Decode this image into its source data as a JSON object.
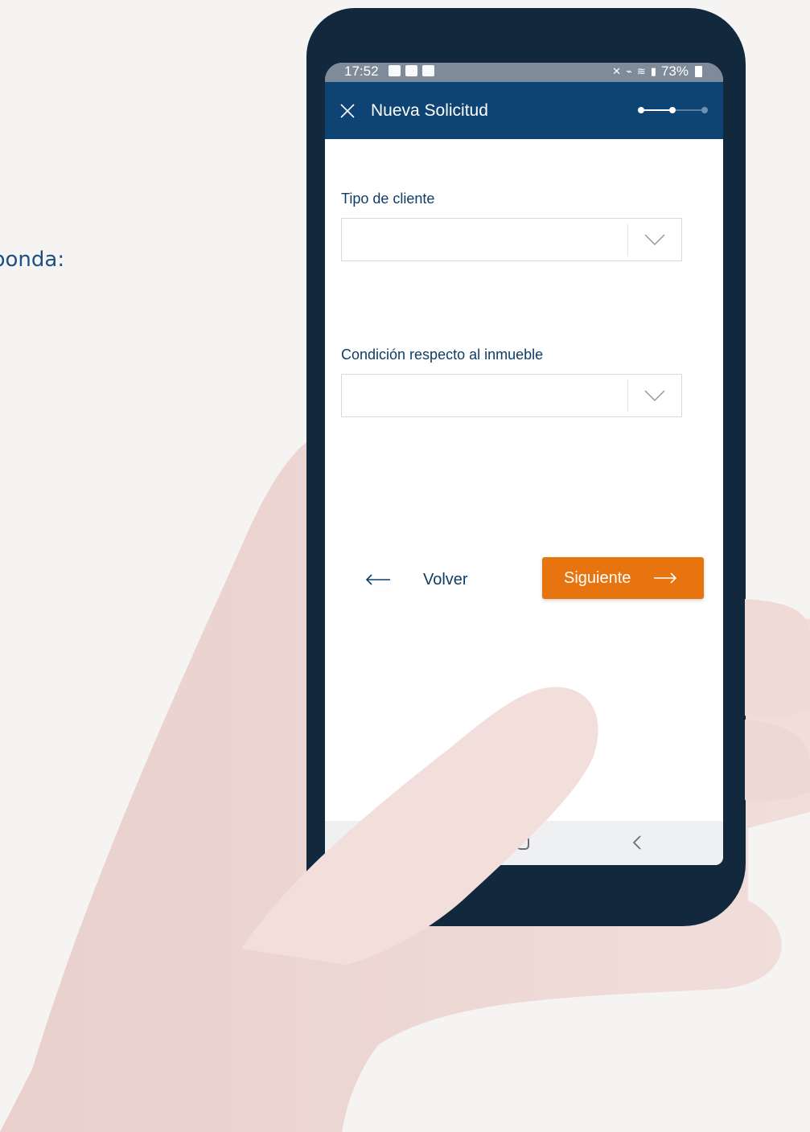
{
  "background_text": "ponda:",
  "status_bar": {
    "time": "17:52",
    "battery": "73%",
    "left_icons": [
      "image-icon",
      "sync-icon",
      "calendar-icon"
    ],
    "right_icons": [
      "mute-icon",
      "lte-icon",
      "wifi-icon",
      "signal-icon",
      "battery-icon"
    ]
  },
  "app_bar": {
    "title": "Nueva Solicitud",
    "close_icon": "close-icon",
    "stepper": {
      "total_steps": 3,
      "current_step": 2
    }
  },
  "form": {
    "fields": [
      {
        "label": "Tipo de cliente",
        "value": "",
        "icon": "chevron-down-icon"
      },
      {
        "label": "Condición respecto al inmueble",
        "value": "",
        "icon": "chevron-down-icon"
      }
    ]
  },
  "actions": {
    "back_label": "Volver",
    "next_label": "Siguiente"
  },
  "colors": {
    "primary": "#0e4473",
    "accent": "#e8740f",
    "label_text": "#0f3d66",
    "phone_body": "#11283d",
    "hand": "#f0dcd9"
  },
  "nav_bar": {
    "icons": [
      "home-icon",
      "back-icon"
    ]
  }
}
